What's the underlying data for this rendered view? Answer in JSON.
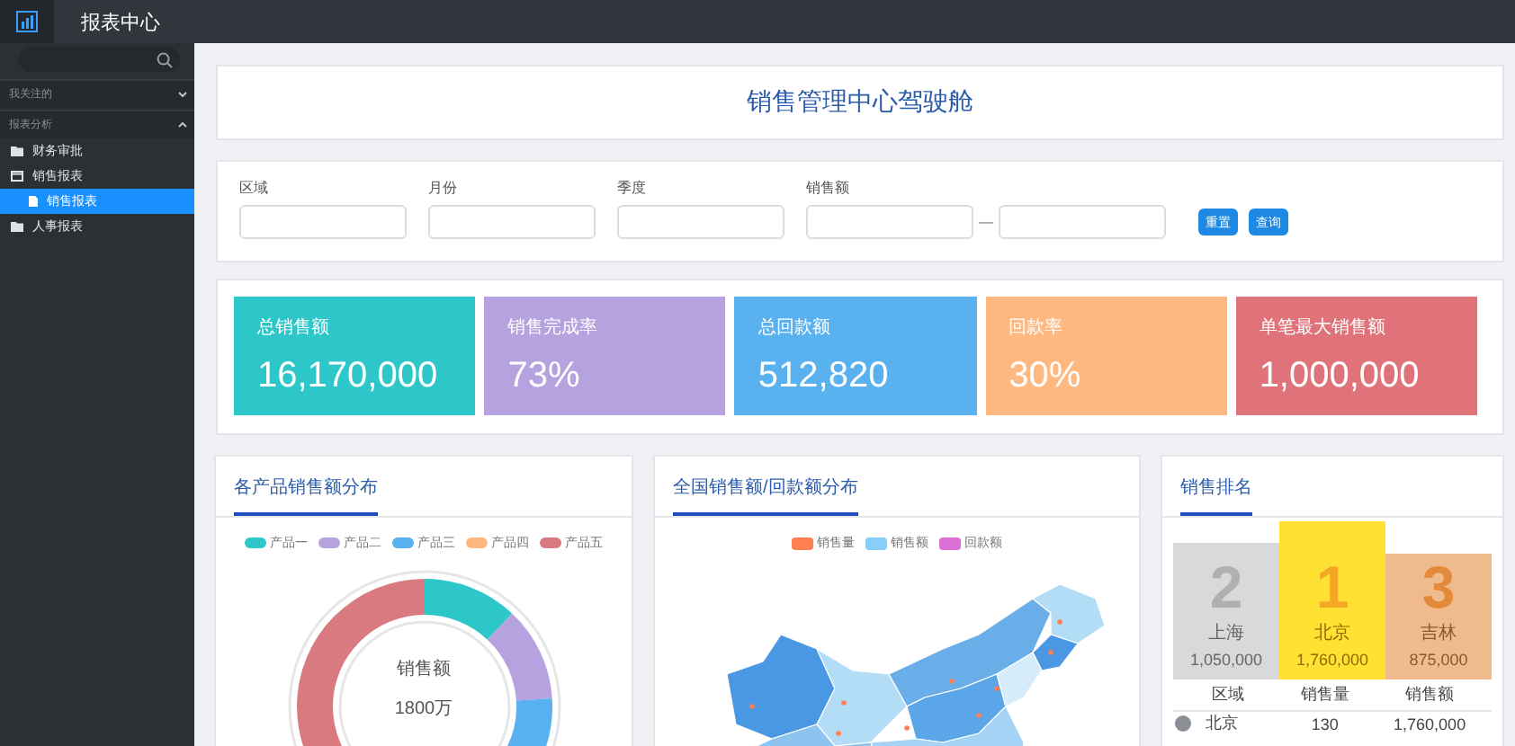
{
  "topbar": {
    "title": "报表中心"
  },
  "sidebar": {
    "groups": [
      {
        "label": "我关注的",
        "expanded": false
      },
      {
        "label": "报表分析",
        "expanded": true,
        "children": [
          {
            "label": "财务审批",
            "expanded": false,
            "selected": false
          },
          {
            "label": "销售报表",
            "expanded": true,
            "selected": false,
            "children": [
              {
                "label": "销售报表",
                "selected": true
              }
            ]
          },
          {
            "label": "人事报表",
            "expanded": false,
            "selected": false
          }
        ]
      }
    ]
  },
  "page_title": "销售管理中心驾驶舱",
  "filters": {
    "fields": [
      {
        "label": "区域",
        "kind": "single"
      },
      {
        "label": "月份",
        "kind": "single"
      },
      {
        "label": "季度",
        "kind": "single"
      },
      {
        "label": "销售额",
        "kind": "range",
        "separator": "—"
      }
    ],
    "buttons": [
      "重置",
      "查询"
    ]
  },
  "kpis": [
    {
      "label": "总销售额",
      "value": "16,170,000",
      "color": "#2ec7c9"
    },
    {
      "label": "销售完成率",
      "value": "73%",
      "color": "#b6a2de"
    },
    {
      "label": "总回款额",
      "value": "512,820",
      "color": "#5ab1ef"
    },
    {
      "label": "回款率",
      "value": "30%",
      "color": "#ffb980"
    },
    {
      "label": "单笔最大销售额",
      "value": "1,000,000",
      "color": "#e0737a"
    }
  ],
  "product_share": {
    "title": "各产品销售额分布",
    "legend": [
      {
        "label": "产品一",
        "color": "#2ec7c9"
      },
      {
        "label": "产品二",
        "color": "#b6a2de"
      },
      {
        "label": "产品三",
        "color": "#5ab1ef"
      },
      {
        "label": "产品四",
        "color": "#ffb980"
      },
      {
        "label": "产品五",
        "color": "#d87a80"
      }
    ],
    "center_label": "销售额",
    "center_value": "1800万"
  },
  "map": {
    "title": "全国销售额/回款额分布",
    "legend": [
      {
        "label": "销售量",
        "color": "#ff7f50"
      },
      {
        "label": "销售额",
        "color": "#87cefa"
      },
      {
        "label": "回款额",
        "color": "#da70d6"
      }
    ]
  },
  "ranking": {
    "title": "销售排名",
    "podium": [
      {
        "kind": "second",
        "rank": "2",
        "city": "上海",
        "amount": "1,050,000"
      },
      {
        "kind": "first",
        "rank": "1",
        "city": "北京",
        "amount": "1,760,000"
      },
      {
        "kind": "third",
        "rank": "3",
        "city": "吉林",
        "amount": "875,000"
      }
    ],
    "columns": [
      "区域",
      "销售量",
      "销售额"
    ],
    "rows": [
      {
        "region": "北京",
        "quantity": "130",
        "amount": "1,760,000"
      }
    ]
  }
}
